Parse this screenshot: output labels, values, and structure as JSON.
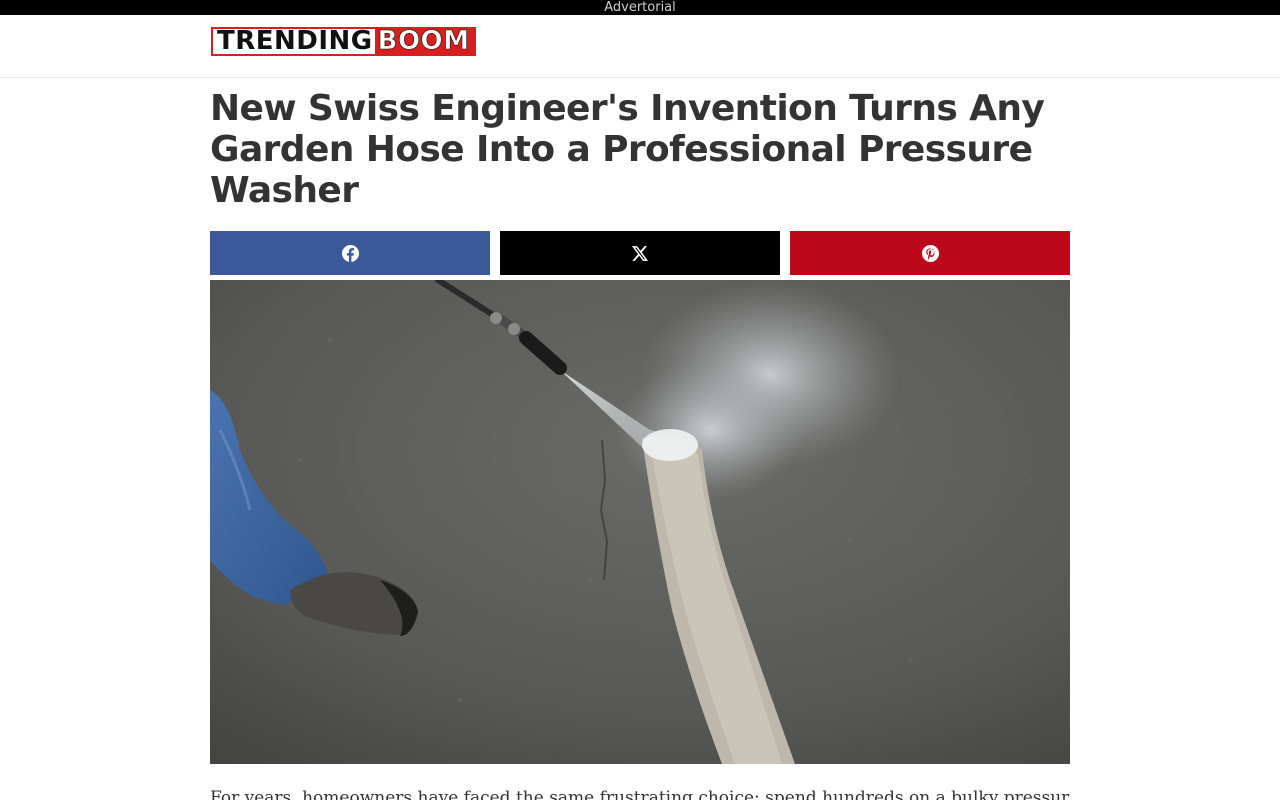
{
  "topbar": {
    "label": "Advertorial"
  },
  "header": {
    "logo": {
      "part1": "TRENDING",
      "part2": "BOOM"
    }
  },
  "article": {
    "headline": "New Swiss Engineer's Invention Turns Any Garden Hose Into a Professional Pressure Washer",
    "intro": "For years, homeowners have faced the same frustrating choice: spend hundreds on a bulky pressure"
  },
  "share": [
    {
      "network": "facebook",
      "icon": "facebook-icon",
      "color": "#3b5998"
    },
    {
      "network": "x",
      "icon": "x-icon",
      "color": "#000000"
    },
    {
      "network": "pinterest",
      "icon": "pinterest-icon",
      "color": "#bd081c"
    }
  ],
  "colors": {
    "brand_red": "#d81e1e",
    "headline": "#333333",
    "topbar_bg": "#000000"
  }
}
